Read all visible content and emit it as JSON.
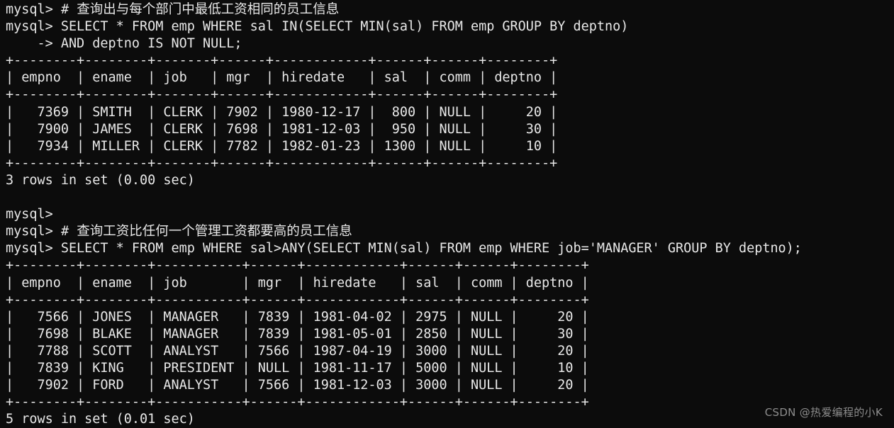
{
  "terminal": {
    "prompt": "mysql> ",
    "continuation_prompt": "    -> ",
    "background_color": "#0c0c0c",
    "text_color": "#e8e8e8",
    "lines": [
      "mysql> # 查询出与每个部门中最低工资相同的员工信息",
      "mysql> SELECT * FROM emp WHERE sal IN(SELECT MIN(sal) FROM emp GROUP BY deptno)",
      "    -> AND deptno IS NOT NULL;",
      "+--------+--------+-------+------+------------+------+------+--------+",
      "| empno  | ename  | job   | mgr  | hiredate   | sal  | comm | deptno |",
      "+--------+--------+-------+------+------------+------+------+--------+",
      "|   7369 | SMITH  | CLERK | 7902 | 1980-12-17 |  800 | NULL |     20 |",
      "|   7900 | JAMES  | CLERK | 7698 | 1981-12-03 |  950 | NULL |     30 |",
      "|   7934 | MILLER | CLERK | 7782 | 1982-01-23 | 1300 | NULL |     10 |",
      "+--------+--------+-------+------+------------+------+------+--------+",
      "3 rows in set (0.00 sec)",
      "",
      "mysql>",
      "mysql> # 查询工资比任何一个管理工资都要高的员工信息",
      "mysql> SELECT * FROM emp WHERE sal>ANY(SELECT MIN(sal) FROM emp WHERE job='MANAGER' GROUP BY deptno);",
      "+--------+--------+-----------+------+------------+------+------+--------+",
      "| empno  | ename  | job       | mgr  | hiredate   | sal  | comm | deptno |",
      "+--------+--------+-----------+------+------------+------+------+--------+",
      "|   7566 | JONES  | MANAGER   | 7839 | 1981-04-02 | 2975 | NULL |     20 |",
      "|   7698 | BLAKE  | MANAGER   | 7839 | 1981-05-01 | 2850 | NULL |     30 |",
      "|   7788 | SCOTT  | ANALYST   | 7566 | 1987-04-19 | 3000 | NULL |     20 |",
      "|   7839 | KING   | PRESIDENT | NULL | 1981-11-17 | 5000 | NULL |     10 |",
      "|   7902 | FORD   | ANALYST   | 7566 | 1981-12-03 | 3000 | NULL |     20 |",
      "+--------+--------+-----------+------+------------+------+------+--------+",
      "5 rows in set (0.01 sec)"
    ],
    "queries": [
      {
        "comment": "# 查询出与每个部门中最低工资相同的员工信息",
        "sql": "SELECT * FROM emp WHERE sal IN(SELECT MIN(sal) FROM emp GROUP BY deptno) AND deptno IS NOT NULL;",
        "columns": [
          "empno",
          "ename",
          "job",
          "mgr",
          "hiredate",
          "sal",
          "comm",
          "deptno"
        ],
        "rows": [
          [
            "7369",
            "SMITH",
            "CLERK",
            "7902",
            "1980-12-17",
            "800",
            "NULL",
            "20"
          ],
          [
            "7900",
            "JAMES",
            "CLERK",
            "7698",
            "1981-12-03",
            "950",
            "NULL",
            "30"
          ],
          [
            "7934",
            "MILLER",
            "CLERK",
            "7782",
            "1982-01-23",
            "1300",
            "NULL",
            "10"
          ]
        ],
        "status": "3 rows in set (0.00 sec)"
      },
      {
        "comment": "# 查询工资比任何一个管理工资都要高的员工信息",
        "sql": "SELECT * FROM emp WHERE sal>ANY(SELECT MIN(sal) FROM emp WHERE job='MANAGER' GROUP BY deptno);",
        "columns": [
          "empno",
          "ename",
          "job",
          "mgr",
          "hiredate",
          "sal",
          "comm",
          "deptno"
        ],
        "rows": [
          [
            "7566",
            "JONES",
            "MANAGER",
            "7839",
            "1981-04-02",
            "2975",
            "NULL",
            "20"
          ],
          [
            "7698",
            "BLAKE",
            "MANAGER",
            "7839",
            "1981-05-01",
            "2850",
            "NULL",
            "30"
          ],
          [
            "7788",
            "SCOTT",
            "ANALYST",
            "7566",
            "1987-04-19",
            "3000",
            "NULL",
            "20"
          ],
          [
            "7839",
            "KING",
            "PRESIDENT",
            "NULL",
            "1981-11-17",
            "5000",
            "NULL",
            "10"
          ],
          [
            "7902",
            "FORD",
            "ANALYST",
            "7566",
            "1981-12-03",
            "3000",
            "NULL",
            "20"
          ]
        ],
        "status": "5 rows in set (0.01 sec)"
      }
    ]
  },
  "watermark": {
    "text": "CSDN @热爱编程的小K"
  }
}
